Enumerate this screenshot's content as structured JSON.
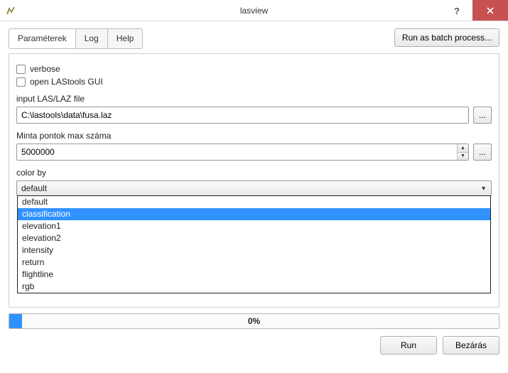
{
  "window": {
    "title": "lasview"
  },
  "toolbar": {
    "batch_button": "Run as batch process..."
  },
  "tabs": {
    "parameters": "Paraméterek",
    "log": "Log",
    "help": "Help"
  },
  "params": {
    "verbose_label": "verbose",
    "gui_label": "open LAStools GUI",
    "input_file_label": "input LAS/LAZ file",
    "input_file_value": "C:\\lastools\\data\\fusa.laz",
    "browse_button": "...",
    "max_points_label": "Minta pontok max száma",
    "max_points_value": "5000000",
    "color_by_label": "color by",
    "color_by_selected": "default",
    "color_by_options": {
      "o0": "default",
      "o1": "classification",
      "o2": "elevation1",
      "o3": "elevation2",
      "o4": "intensity",
      "o5": "return",
      "o6": "flightline",
      "o7": "rgb"
    }
  },
  "progress": {
    "percent_label": "0%"
  },
  "footer": {
    "run": "Run",
    "close": "Bezárás"
  }
}
